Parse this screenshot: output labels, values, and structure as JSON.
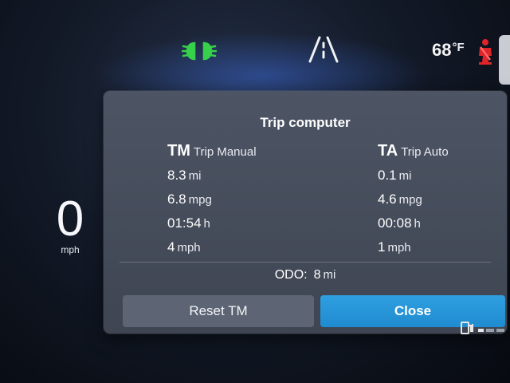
{
  "status": {
    "temperature_value": "68",
    "temperature_unit": "°F",
    "icons": [
      "headlight-icon",
      "lane-assist-icon",
      "seatbelt-warning-icon",
      "fuel-indicator-icon"
    ],
    "colors": {
      "headlight": "#37d04a",
      "warning": "#e0242a",
      "accent": "#2196d8"
    }
  },
  "speedometer": {
    "value": "0",
    "unit": "mph"
  },
  "trip_computer": {
    "title": "Trip computer",
    "tm": {
      "abbr": "TM",
      "name": "Trip Manual",
      "rows": [
        {
          "value": "8.3",
          "unit": "mi"
        },
        {
          "value": "6.8",
          "unit": "mpg"
        },
        {
          "value": "01:54",
          "unit": "h"
        },
        {
          "value": "4",
          "unit": "mph"
        }
      ]
    },
    "ta": {
      "abbr": "TA",
      "name": "Trip Auto",
      "rows": [
        {
          "value": "0.1",
          "unit": "mi"
        },
        {
          "value": "4.6",
          "unit": "mpg"
        },
        {
          "value": "00:08",
          "unit": "h"
        },
        {
          "value": "1",
          "unit": "mph"
        }
      ]
    },
    "odo": {
      "label": "ODO:",
      "value": "8",
      "unit": "mi"
    },
    "buttons": {
      "reset_label": "Reset TM",
      "close_label": "Close"
    }
  }
}
